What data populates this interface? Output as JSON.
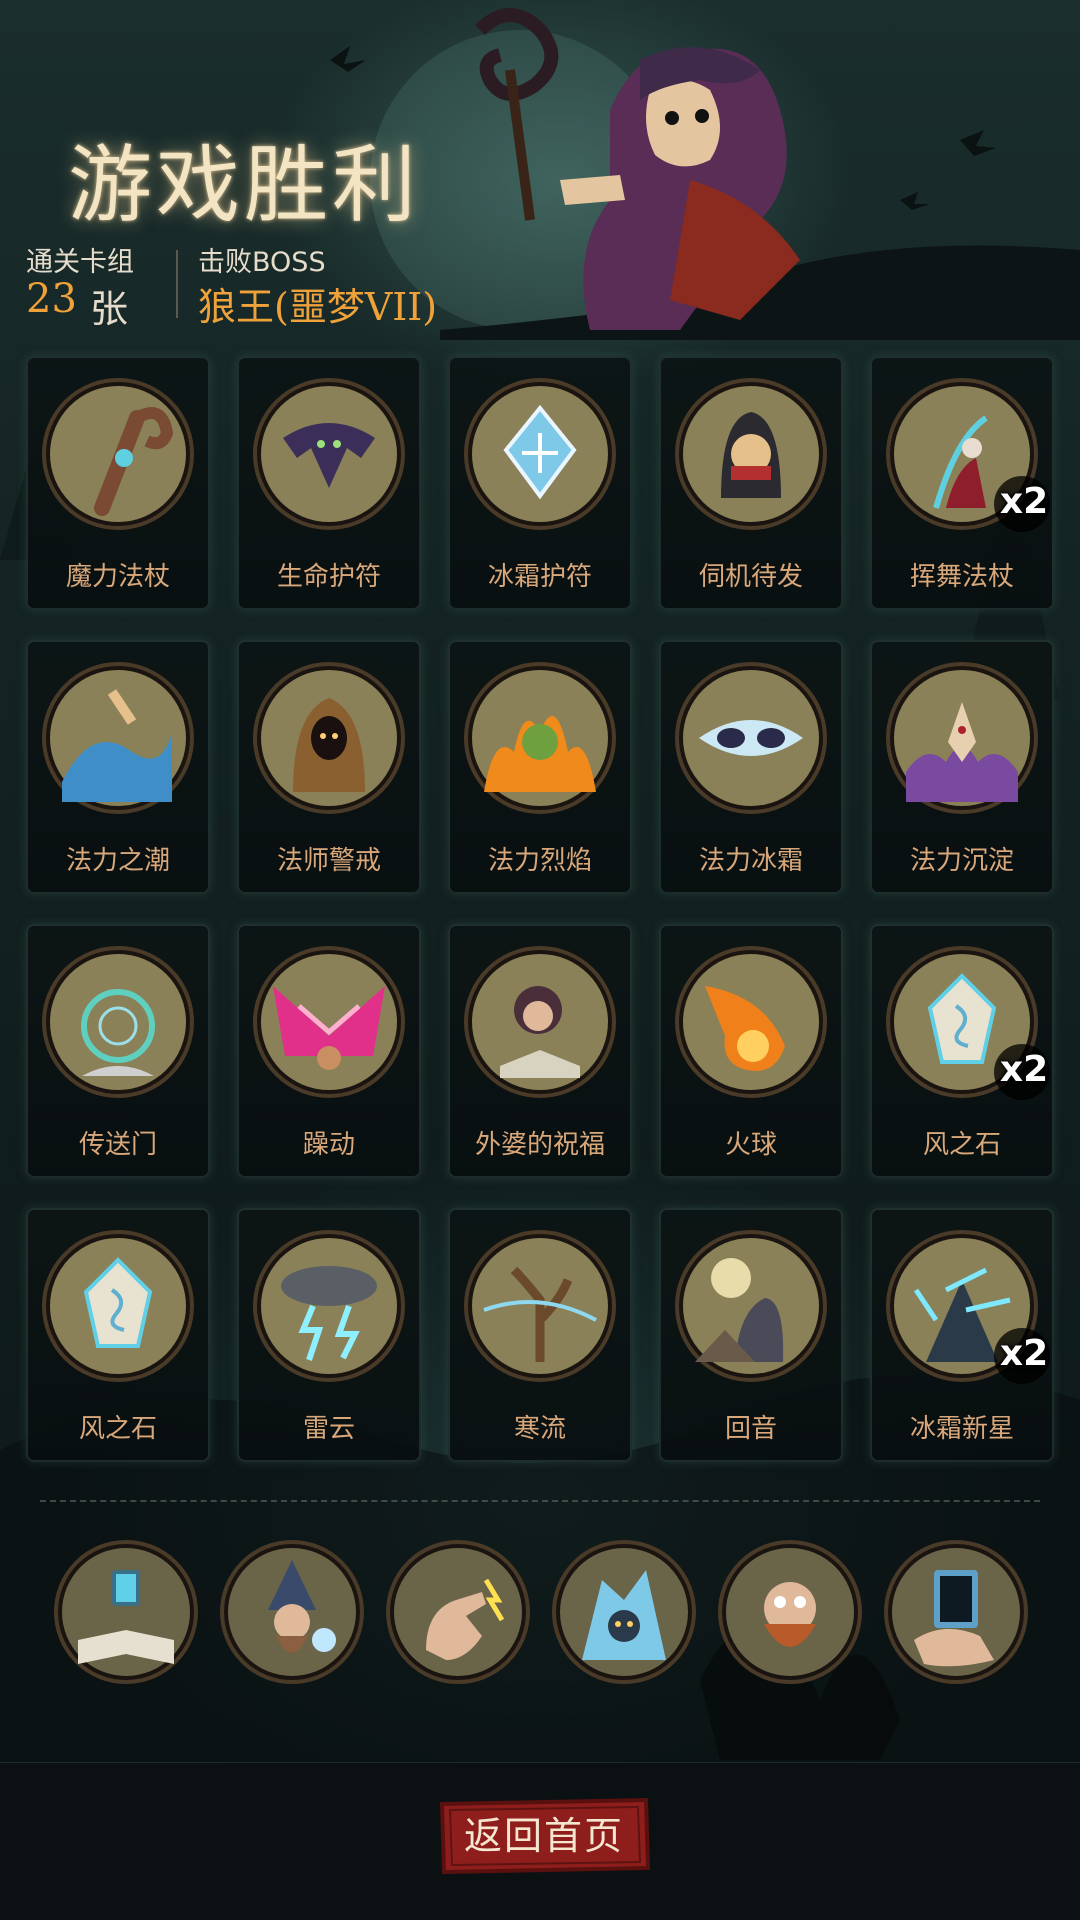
{
  "header": {
    "title": "游戏胜利",
    "deck_label": "通关卡组",
    "deck_count": "23",
    "deck_unit": "张",
    "boss_label": "击败BOSS",
    "boss_name": "狼王(噩梦VII)"
  },
  "cards": [
    {
      "label": "魔力法杖",
      "icon": "magic-staff-icon"
    },
    {
      "label": "生命护符",
      "icon": "bat-amulet-icon"
    },
    {
      "label": "冰霜护符",
      "icon": "frost-amulet-icon"
    },
    {
      "label": "伺机待发",
      "icon": "hooded-rogue-icon"
    },
    {
      "label": "挥舞法杖",
      "icon": "witch-staff-icon",
      "badge": "x2"
    },
    {
      "label": "法力之潮",
      "icon": "water-tide-icon"
    },
    {
      "label": "法师警戒",
      "icon": "hooded-mage-icon"
    },
    {
      "label": "法力烈焰",
      "icon": "fire-zombie-icon"
    },
    {
      "label": "法力冰霜",
      "icon": "ice-mask-icon"
    },
    {
      "label": "法力沉淀",
      "icon": "purple-mist-icon"
    },
    {
      "label": "传送门",
      "icon": "portal-icon"
    },
    {
      "label": "躁动",
      "icon": "rage-icon"
    },
    {
      "label": "外婆的祝福",
      "icon": "grandma-book-icon"
    },
    {
      "label": "火球",
      "icon": "fireball-icon"
    },
    {
      "label": "风之石",
      "icon": "wind-stone-icon",
      "badge": "x2"
    },
    {
      "label": "风之石",
      "icon": "wind-stone-icon"
    },
    {
      "label": "雷云",
      "icon": "thunder-cloud-icon"
    },
    {
      "label": "寒流",
      "icon": "cold-wind-icon"
    },
    {
      "label": "回音",
      "icon": "werewolf-moon-icon"
    },
    {
      "label": "冰霜新星",
      "icon": "frost-nova-icon",
      "badge": "x2"
    }
  ],
  "relics": [
    {
      "icon": "spellbook-relic-icon"
    },
    {
      "icon": "wizard-relic-icon"
    },
    {
      "icon": "snapping-hand-relic-icon"
    },
    {
      "icon": "ice-golem-relic-icon"
    },
    {
      "icon": "crazy-dwarf-relic-icon"
    },
    {
      "icon": "card-hand-relic-icon"
    }
  ],
  "footer": {
    "home_label": "返回首页"
  },
  "colors": {
    "accent_orange": "#f0a23a",
    "card_label": "#d8a77a",
    "medallion_bg": "#8a8158",
    "button_red": "#8e1e1c"
  }
}
